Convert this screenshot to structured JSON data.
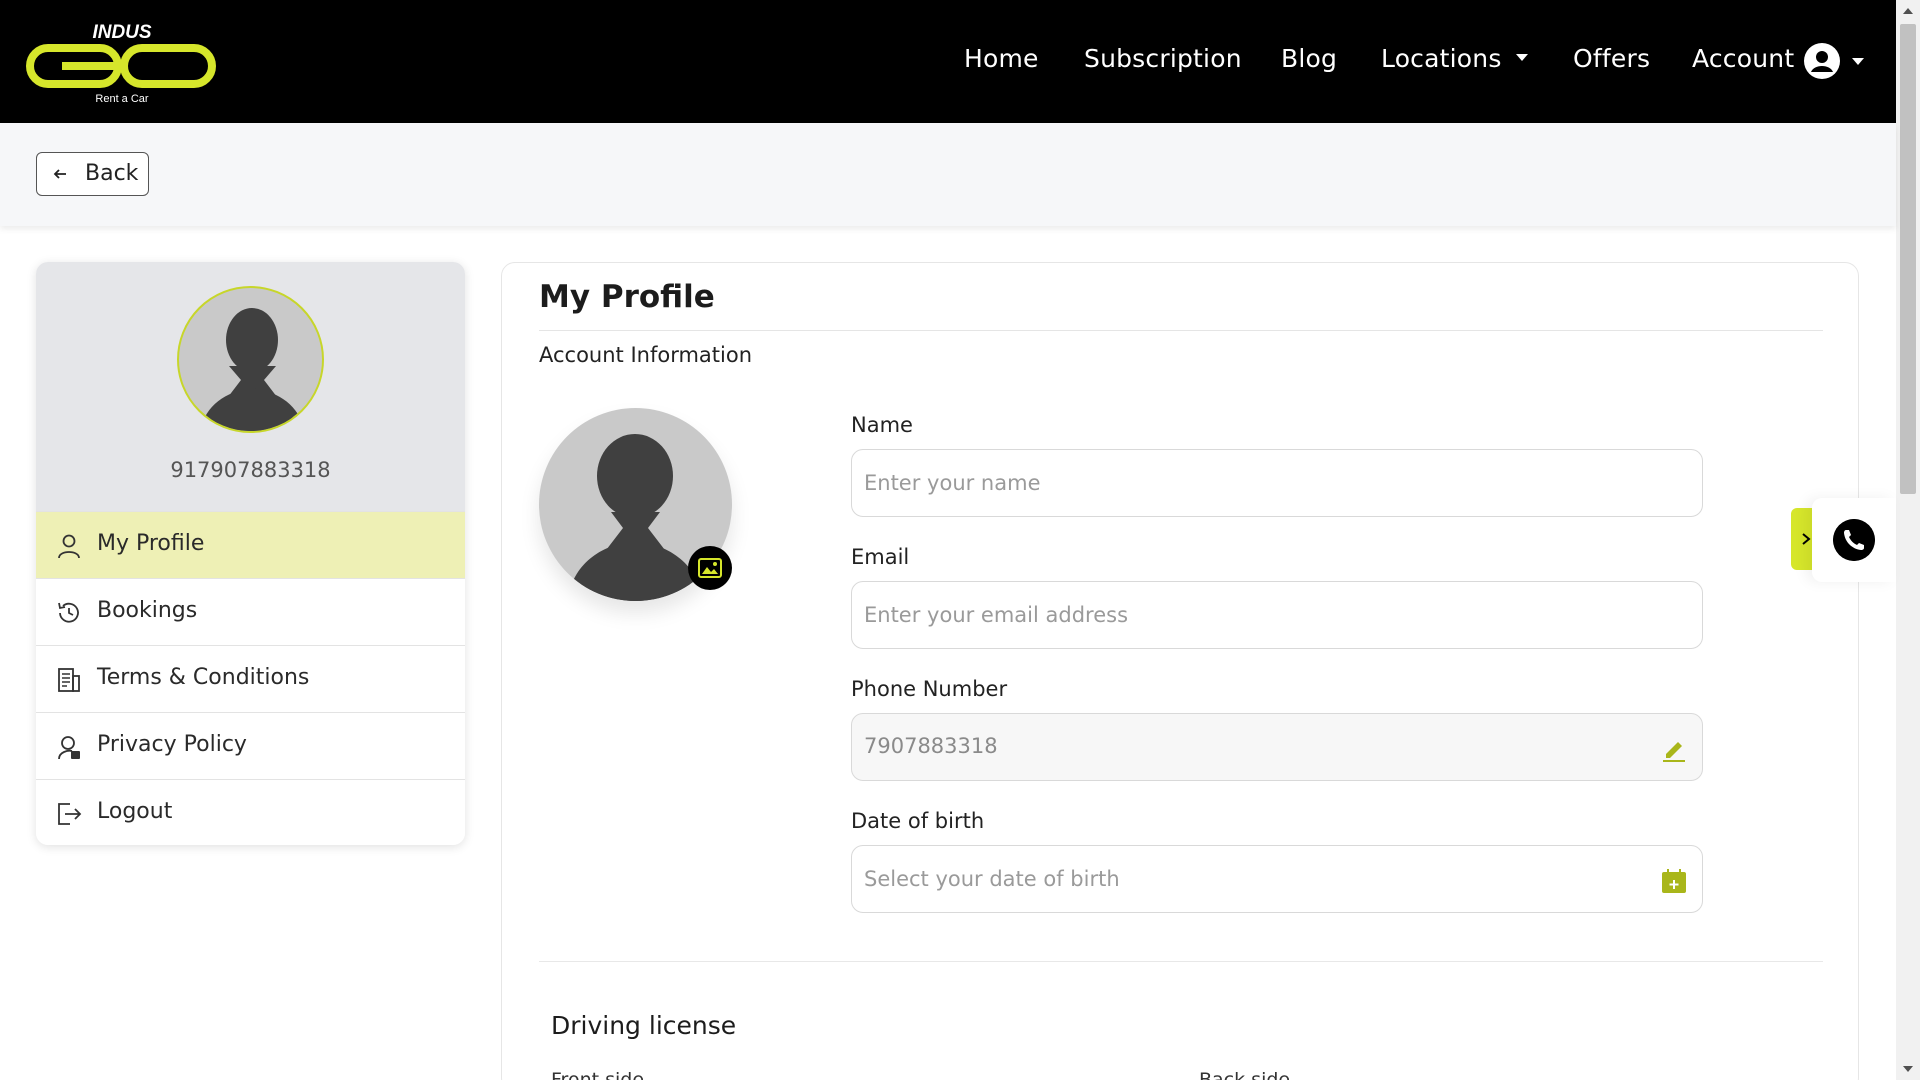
{
  "brand": {
    "logo_top": "INDUS",
    "logo_tagline": "Rent a Car",
    "accent": "#d6e62b"
  },
  "nav": {
    "home": "Home",
    "subscription": "Subscription",
    "blog": "Blog",
    "locations": "Locations",
    "offers": "Offers",
    "account": "Account"
  },
  "subbar": {
    "back_label": "Back"
  },
  "sidebar": {
    "phone": "917907883318",
    "items": [
      {
        "label": "My Profile",
        "icon": "user-icon",
        "active": true
      },
      {
        "label": "Bookings",
        "icon": "history-icon"
      },
      {
        "label": "Terms & Conditions",
        "icon": "document-icon"
      },
      {
        "label": "Privacy Policy",
        "icon": "privacy-icon"
      },
      {
        "label": "Logout",
        "icon": "logout-icon"
      }
    ]
  },
  "profile": {
    "title": "My Profile",
    "section": "Account Information",
    "name": {
      "label": "Name",
      "placeholder": "Enter your name",
      "value": ""
    },
    "email": {
      "label": "Email",
      "placeholder": "Enter your email address",
      "value": ""
    },
    "phone": {
      "label": "Phone Number",
      "value": "7907883318"
    },
    "dob": {
      "label": "Date of birth",
      "placeholder": "Select your date of birth",
      "value": ""
    }
  },
  "license": {
    "title": "Driving license",
    "front": "Front side",
    "back": "Back side"
  }
}
